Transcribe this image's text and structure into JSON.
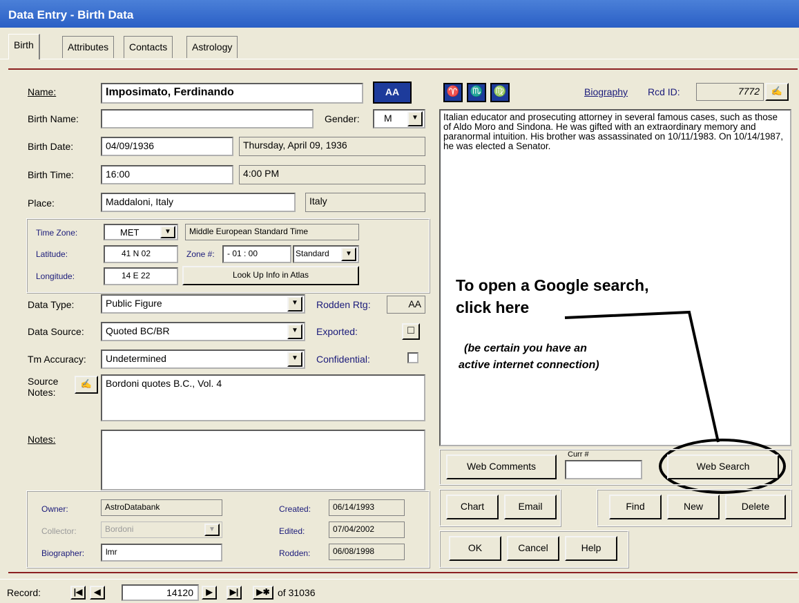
{
  "window": {
    "title": "Data Entry - Birth Data"
  },
  "tabs": [
    "Birth",
    "Attributes",
    "Contacts",
    "Astrology"
  ],
  "labels": {
    "name": "Name:",
    "birth_name": "Birth Name:",
    "birth_date": "Birth Date:",
    "birth_time": "Birth Time:",
    "place": "Place:",
    "gender": "Gender:",
    "time_zone": "Time Zone:",
    "latitude": "Latitude:",
    "longitude": "Longitude:",
    "zone_num": "Zone #:",
    "data_type": "Data Type:",
    "data_source": "Data Source:",
    "tm_accuracy": "Tm Accuracy:",
    "source_notes": "Source Notes:",
    "notes": "Notes:",
    "rodden_rtg": "Rodden Rtg:",
    "exported": "Exported:",
    "confidential": "Confidential:",
    "biography": "Biography",
    "rcd_id": "Rcd ID:",
    "owner": "Owner:",
    "collector": "Collector:",
    "biographer": "Biographer:",
    "created": "Created:",
    "edited": "Edited:",
    "rodden": "Rodden:",
    "curr_num": "Curr #"
  },
  "fields": {
    "name": "Imposimato, Ferdinando",
    "name_button": "AA",
    "birth_name": "",
    "gender": "M",
    "birth_date": "04/09/1936",
    "birth_date_long": "Thursday, April 09, 1936",
    "birth_time": "16:00",
    "birth_time_long": "4:00 PM",
    "place": "Maddaloni, Italy",
    "country": "Italy",
    "time_zone": "MET",
    "time_zone_long": "Middle European Standard Time",
    "latitude": "41 N 02",
    "longitude": "14 E 22",
    "zone_offset": "- 01 : 00",
    "zone_type": "Standard",
    "data_type": "Public Figure",
    "data_source": "Quoted BC/BR",
    "tm_accuracy": "Undetermined",
    "rodden_rating": "AA",
    "source_notes": "Bordoni quotes B.C., Vol. 4",
    "notes": "",
    "rcd_id": "7772",
    "owner": "AstroDatabank",
    "collector": "Bordoni",
    "biographer": "lmr",
    "created": "06/14/1993",
    "edited": "07/04/2002",
    "rodden": "06/08/1998",
    "curr_num": ""
  },
  "zodiac": [
    "♈",
    "♏",
    "♍"
  ],
  "biography_text": "Italian educator and prosecuting attorney in several famous cases, such as those of Aldo Moro and Sindona. He was gifted with an extraordinary memory and paranormal intuition.  His brother was assassinated on 10/11/1983.  On 10/14/1987, he was elected a Senator.",
  "buttons": {
    "look_up": "Look Up Info in Atlas",
    "web_comments": "Web Comments",
    "web_search": "Web Search",
    "chart": "Chart",
    "email": "Email",
    "find": "Find",
    "new": "New",
    "delete": "Delete",
    "ok": "OK",
    "cancel": "Cancel",
    "help": "Help"
  },
  "annotation": {
    "line1": "To open a Google search,",
    "line2": "click here",
    "note1": "(be certain you have an",
    "note2": "active internet connection)"
  },
  "record_bar": {
    "label": "Record:",
    "current": "14120",
    "total": "of 31036"
  },
  "icons": {
    "dropdown": "▼",
    "edit": "signature-icon",
    "checkbox_empty": "□"
  },
  "colors": {
    "title_bar": "#2a5fc5",
    "accent_dark_red": "#8b2020",
    "zodiac_blue": "#1d3b9b",
    "window_bg": "#ece9d8"
  }
}
